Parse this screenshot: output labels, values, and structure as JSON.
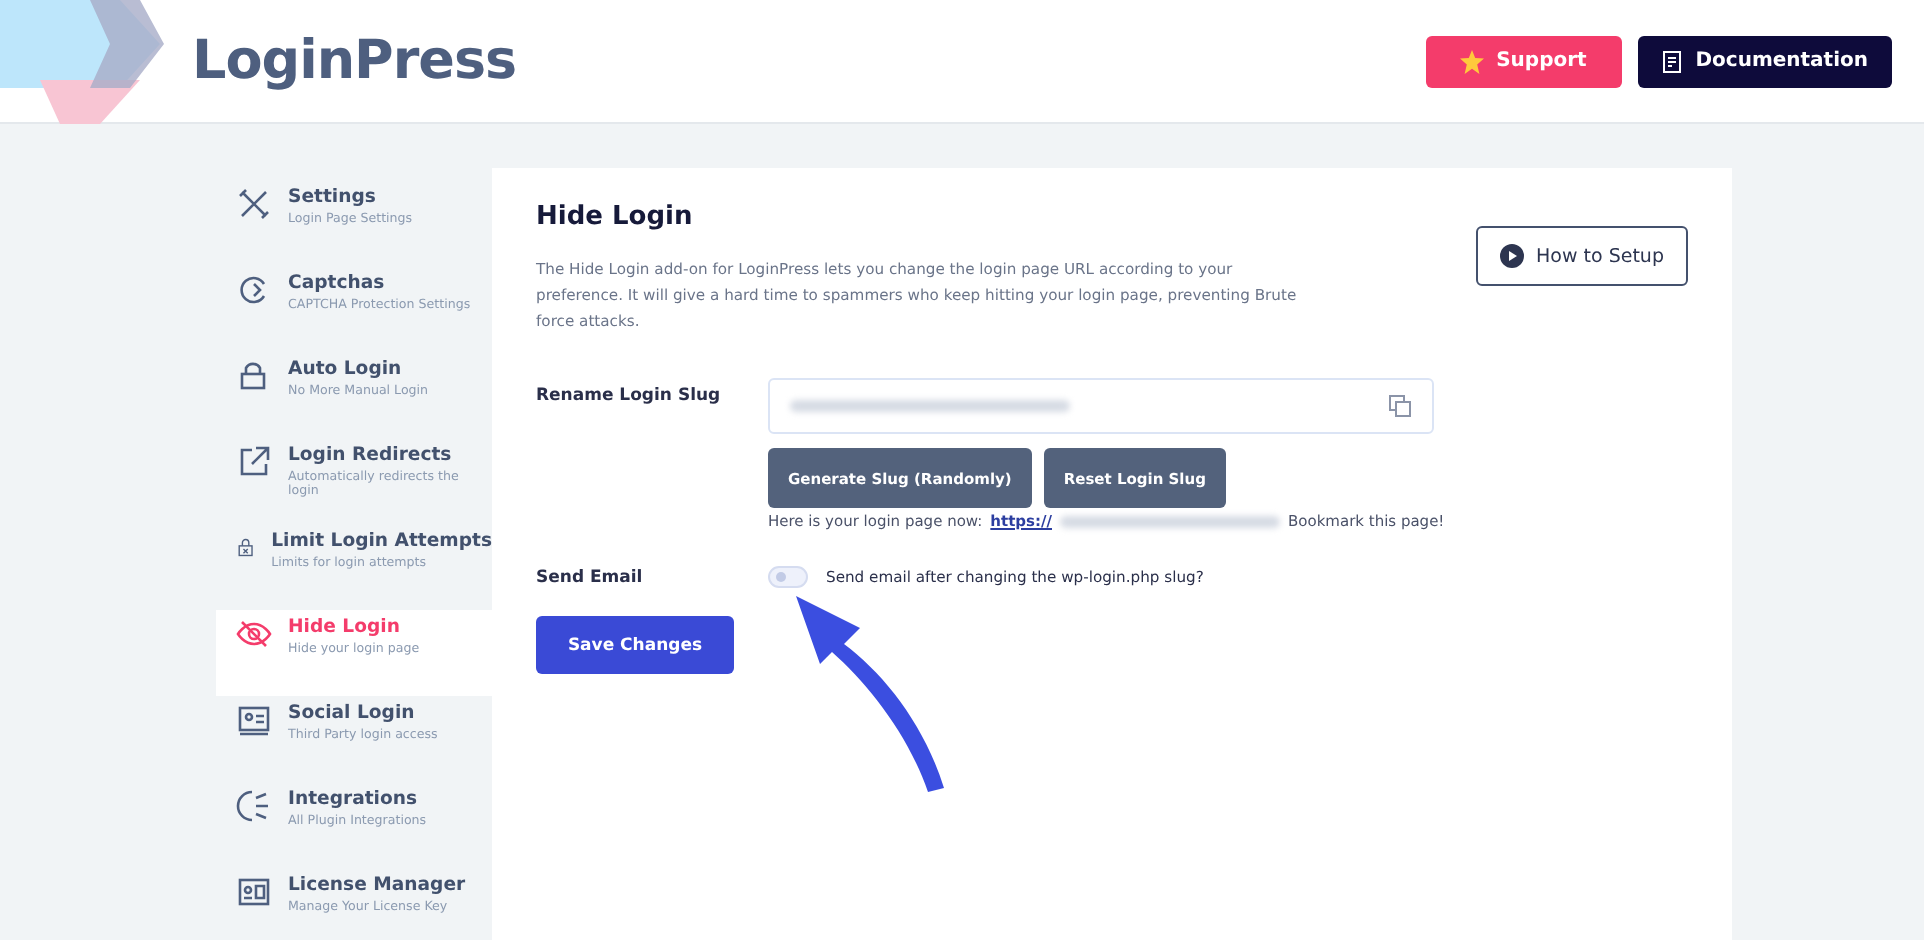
{
  "header": {
    "logo": "LoginPress",
    "buttons": [
      {
        "label": "Support",
        "kind": "support"
      },
      {
        "label": "Documentation",
        "kind": "docs"
      }
    ]
  },
  "sidebar": {
    "items": [
      {
        "title": "Settings",
        "subtitle": "Login Page Settings",
        "selected": false
      },
      {
        "title": "Captchas",
        "subtitle": "CAPTCHA Protection Settings",
        "selected": false
      },
      {
        "title": "Auto Login",
        "subtitle": "No More Manual Login",
        "selected": false
      },
      {
        "title": "Login Redirects",
        "subtitle": "Automatically redirects the login",
        "selected": false
      },
      {
        "title": "Limit Login Attempts",
        "subtitle": "Limits for login attempts",
        "selected": false
      },
      {
        "title": "Hide Login",
        "subtitle": "Hide your login page",
        "selected": true
      },
      {
        "title": "Social Login",
        "subtitle": "Third Party login access",
        "selected": false
      },
      {
        "title": "Integrations",
        "subtitle": "All Plugin Integrations",
        "selected": false
      },
      {
        "title": "License Manager",
        "subtitle": "Manage Your License Key",
        "selected": false
      }
    ]
  },
  "main": {
    "title": "Hide Login",
    "description": "The Hide Login add-on for LoginPress lets you change the login page URL according to your preference. It will give a hard time to spammers who keep hitting your login page, preventing Brute force attacks.",
    "how_to_button": "How to Setup",
    "slug_label": "Rename Login Slug",
    "slug_buttons": [
      "Generate Slug (Randomly)",
      "Reset Login Slug"
    ],
    "login_page_prefix": "Here is your login page now:",
    "login_page_link": "https://",
    "bookmark_note": "Bookmark this page!",
    "email_label": "Send Email",
    "email_toggle": {
      "label": "Send email after changing the wp-login.php slug?",
      "on": false
    },
    "save_button": "Save Changes"
  }
}
